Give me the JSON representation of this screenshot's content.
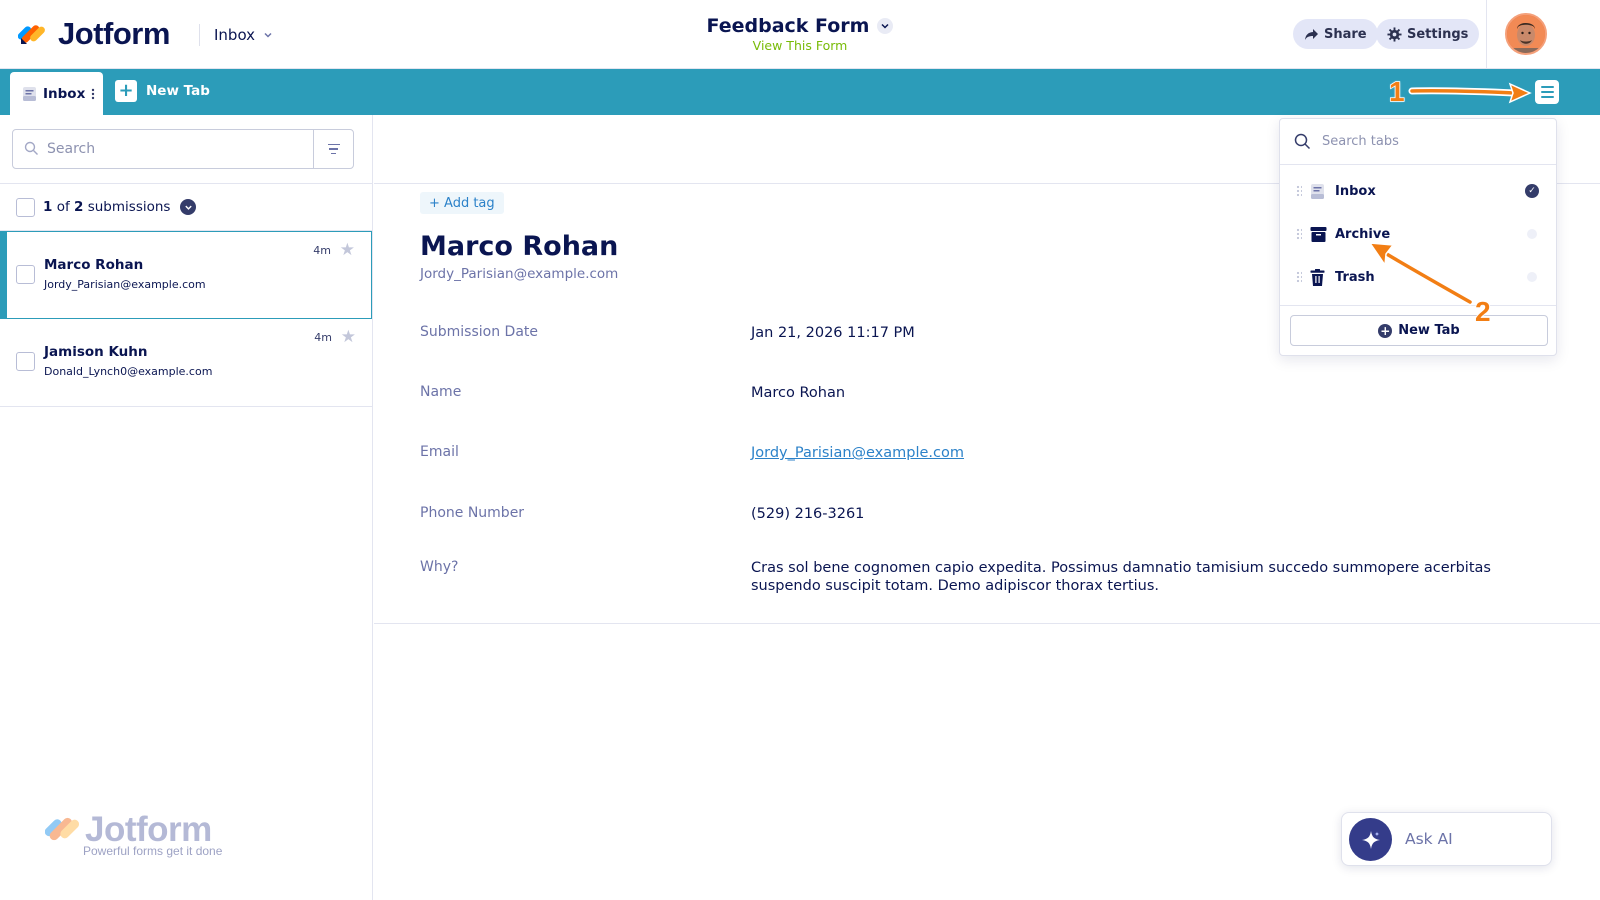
{
  "header": {
    "app_name": "Jotform",
    "inbox_selector": "Inbox",
    "form_title": "Feedback Form",
    "view_form_link": "View This Form",
    "share_label": "Share",
    "settings_label": "Settings"
  },
  "tabs": {
    "active_tab": "Inbox",
    "new_tab": "New Tab"
  },
  "list": {
    "search_placeholder": "Search",
    "count_current": "1",
    "count_of": "of",
    "count_total": "2",
    "count_suffix": "submissions",
    "items": [
      {
        "name": "Marco Rohan",
        "email": "Jordy_Parisian@example.com",
        "time": "4m",
        "selected": true
      },
      {
        "name": "Jamison Kuhn",
        "email": "Donald_Lynch0@example.com",
        "time": "4m",
        "selected": false
      }
    ]
  },
  "submission": {
    "add_tag": "+ Add tag",
    "name": "Marco Rohan",
    "email": "Jordy_Parisian@example.com",
    "fields": [
      {
        "label": "Submission Date",
        "value": "Jan 21, 2026 11:17 PM"
      },
      {
        "label": "Name",
        "value": "Marco Rohan"
      },
      {
        "label": "Email",
        "value": "Jordy_Parisian@example.com"
      },
      {
        "label": "Phone Number",
        "value": "(529) 216-3261"
      },
      {
        "label": "Why?",
        "value": "Cras sol bene cognomen capio expedita. Possimus damnatio tamisium succedo summopere acerbitas suspendo suscipit totam. Demo adipiscor thorax tertius."
      }
    ]
  },
  "tab_menu": {
    "search_placeholder": "Search tabs",
    "items": [
      {
        "label": "Inbox",
        "icon": "inbox-icon",
        "active": true
      },
      {
        "label": "Archive",
        "icon": "archive-icon",
        "active": false
      },
      {
        "label": "Trash",
        "icon": "trash-icon",
        "active": false
      }
    ],
    "new_tab": "New Tab"
  },
  "annotations": {
    "step1": "1",
    "step2": "2"
  },
  "watermark": {
    "brand": "Jotform",
    "tagline": "Powerful forms get it done"
  },
  "ask_ai": {
    "label": "Ask AI"
  },
  "colors": {
    "primary_navy": "#0a1551",
    "tab_bar": "#2c9cb9",
    "accent_green": "#78bb07",
    "link_blue": "#2c82c9",
    "annotation_orange": "#f27e14"
  }
}
